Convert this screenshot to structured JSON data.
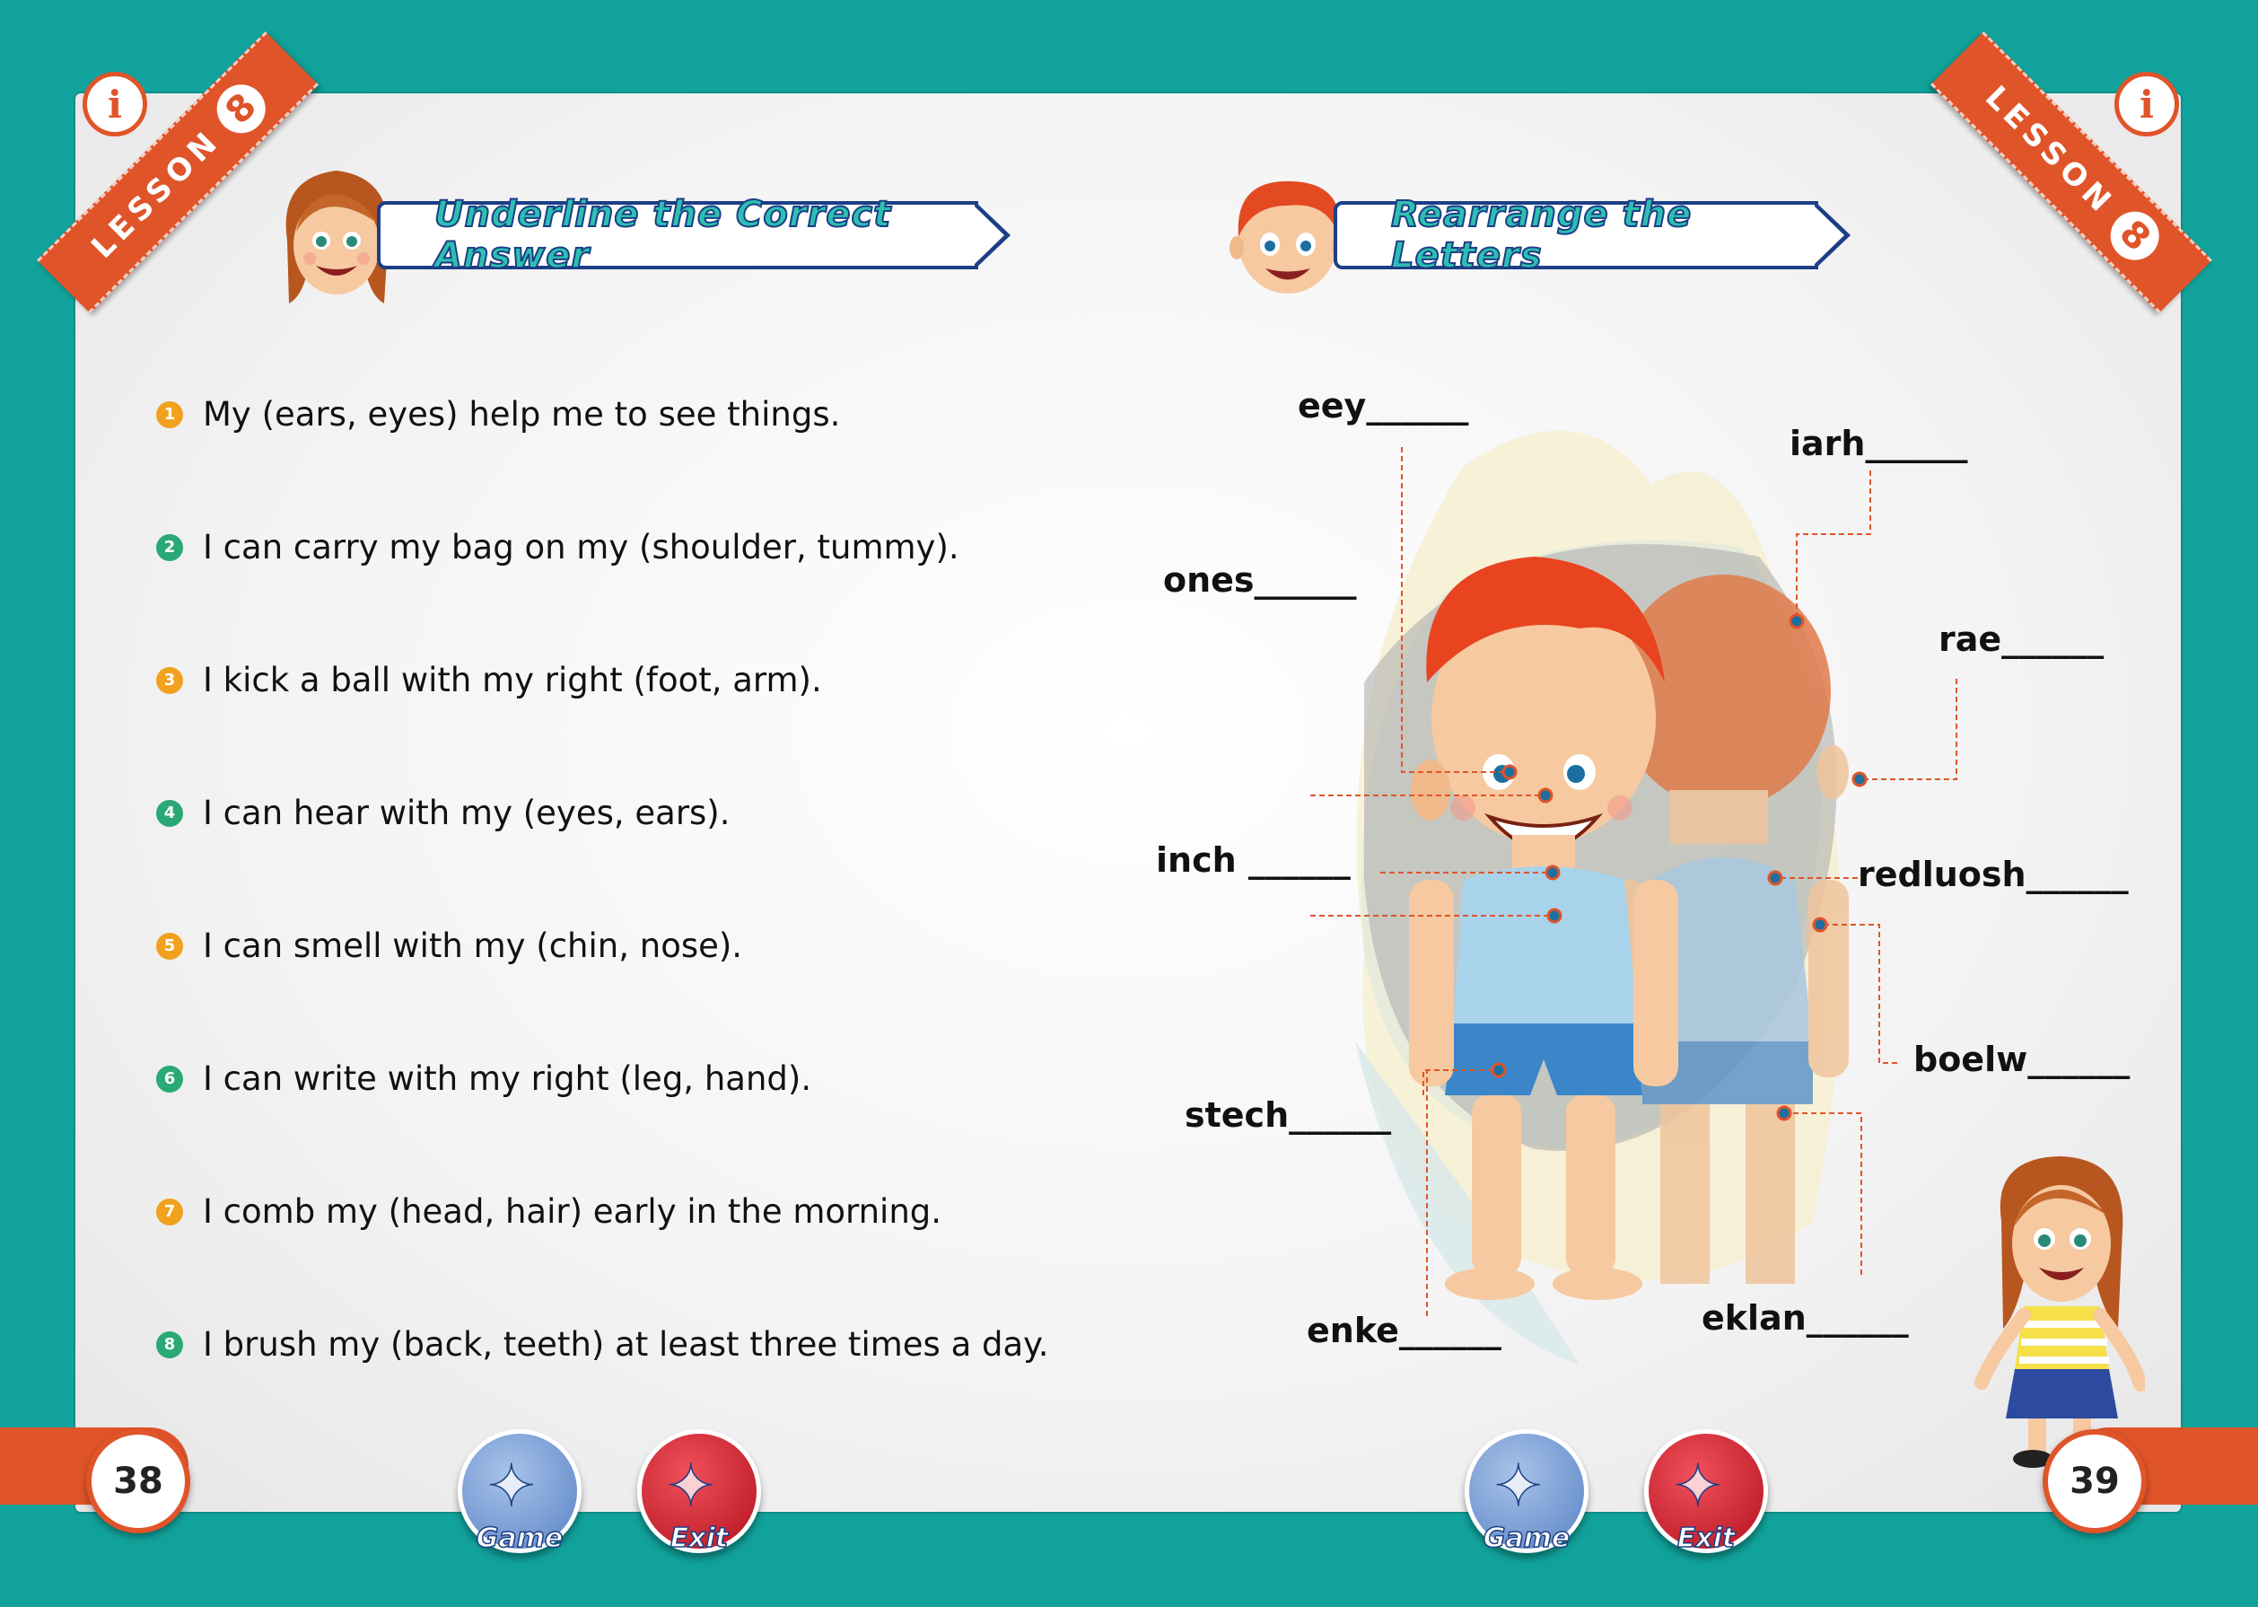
{
  "lesson": {
    "word": "LESSON",
    "number": "8",
    "info_icon": "lightbulb-i-icon"
  },
  "left": {
    "title": "Underline the Correct Answer",
    "questions": [
      {
        "num": "1",
        "text": "My (ears, eyes) help me to see things.",
        "color": "#f2a11f"
      },
      {
        "num": "2",
        "text": "I can carry my bag on my (shoulder, tummy).",
        "color": "#2aa876"
      },
      {
        "num": "3",
        "text": "I kick a ball with my right (foot, arm).",
        "color": "#f2a11f"
      },
      {
        "num": "4",
        "text": "I can hear with my (eyes, ears).",
        "color": "#2aa876"
      },
      {
        "num": "5",
        "text": "I can smell with my (chin, nose).",
        "color": "#f2a11f"
      },
      {
        "num": "6",
        "text": "I can write with my right (leg, hand).",
        "color": "#2aa876"
      },
      {
        "num": "7",
        "text": "I comb my (head, hair) early in the morning.",
        "color": "#f2a11f"
      },
      {
        "num": "8",
        "text": "I brush my (back, teeth) at least three times a day.",
        "color": "#2aa876"
      }
    ],
    "page_number": "38"
  },
  "right": {
    "title": "Rearrange the Letters",
    "labels": [
      "eey______",
      "iarh______",
      "ones______",
      "rae______",
      "inch ______",
      "redluosh______",
      "stech______",
      "boelw______",
      "enke______",
      "eklan______"
    ],
    "page_number": "39"
  },
  "buttons": {
    "game": "Game",
    "exit": "Exit"
  },
  "colors": {
    "teal": "#11a29b",
    "orange": "#e0542a",
    "navy": "#1c3e86",
    "title_fill": "#2dbfb1"
  }
}
